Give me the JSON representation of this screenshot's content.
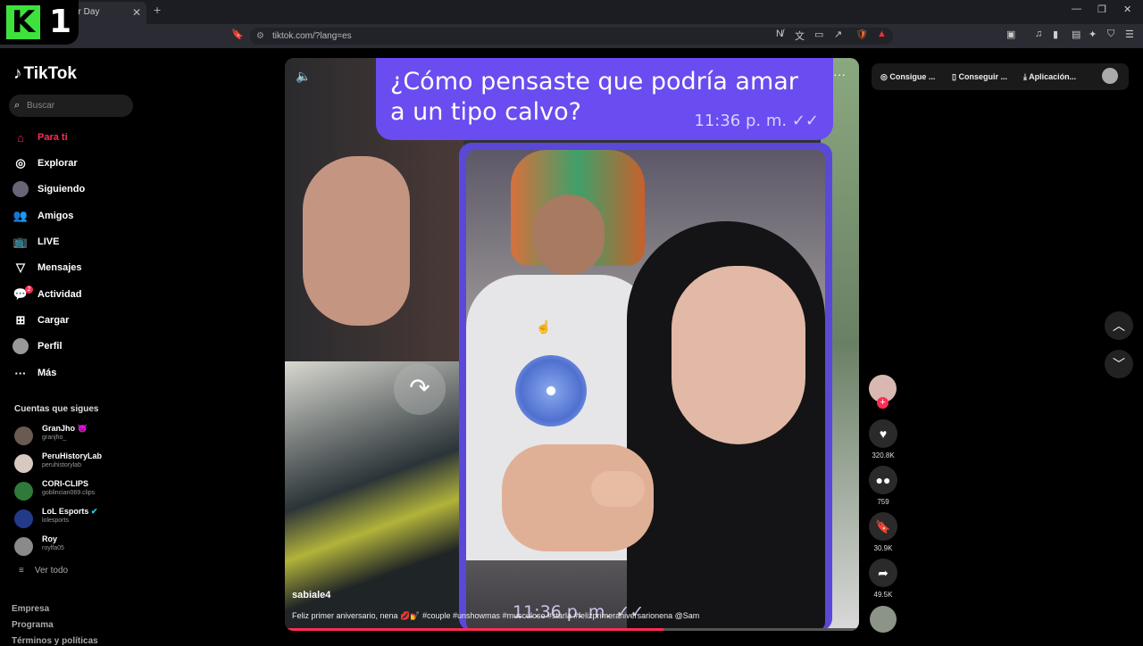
{
  "browser": {
    "tab_title": "ur Day",
    "url": "tiktok.com/?lang=es"
  },
  "overlay_logo": {
    "text": "1"
  },
  "sidebar": {
    "brand": "TikTok",
    "search_placeholder": "Buscar",
    "nav": [
      {
        "label": "Para ti",
        "icon": "home-icon"
      },
      {
        "label": "Explorar",
        "icon": "compass-icon"
      },
      {
        "label": "Siguiendo",
        "icon": "following-avatar-icon"
      },
      {
        "label": "Amigos",
        "icon": "friends-icon"
      },
      {
        "label": "LIVE",
        "icon": "live-icon"
      },
      {
        "label": "Mensajes",
        "icon": "message-icon"
      },
      {
        "label": "Actividad",
        "icon": "activity-icon"
      },
      {
        "label": "Cargar",
        "icon": "upload-icon"
      },
      {
        "label": "Perfil",
        "icon": "profile-avatar-icon"
      },
      {
        "label": "Más",
        "icon": "more-icon"
      }
    ],
    "activity_badge": "2",
    "following_header": "Cuentas que sigues",
    "accounts": [
      {
        "name": "GranJho 😈",
        "handle": "granjho_"
      },
      {
        "name": "PeruHistoryLab",
        "handle": "peruhistorylab"
      },
      {
        "name": "CORI-CLIPS",
        "handle": "goblincian069.clips"
      },
      {
        "name": "LoL Esports",
        "handle": "lolesports"
      },
      {
        "name": "Roy",
        "handle": "roylfa05"
      }
    ],
    "see_all": "Ver todo",
    "footer": [
      "Empresa",
      "Programa",
      "Términos y políticas"
    ]
  },
  "video": {
    "bubble_text": "¿Cómo pensaste que podría amar a un tipo calvo?",
    "bubble_time": "11:36 p. m. ✓✓",
    "watermark_time": "11:36 p. m. ✓✓",
    "author": "sabiale4",
    "caption": "Feliz primer aniversario, nena 💋💅 #couple #unshowmas #musculoso #starla #felizprimeraniversarionena @Sam",
    "progress": 0.66
  },
  "actions": {
    "likes": "320.8K",
    "comments": "759",
    "saves": "30.9K",
    "shares": "49.5K"
  },
  "topright": {
    "btn1": "Consigue ...",
    "btn2": "Conseguir ...",
    "btn3": "Aplicación..."
  }
}
